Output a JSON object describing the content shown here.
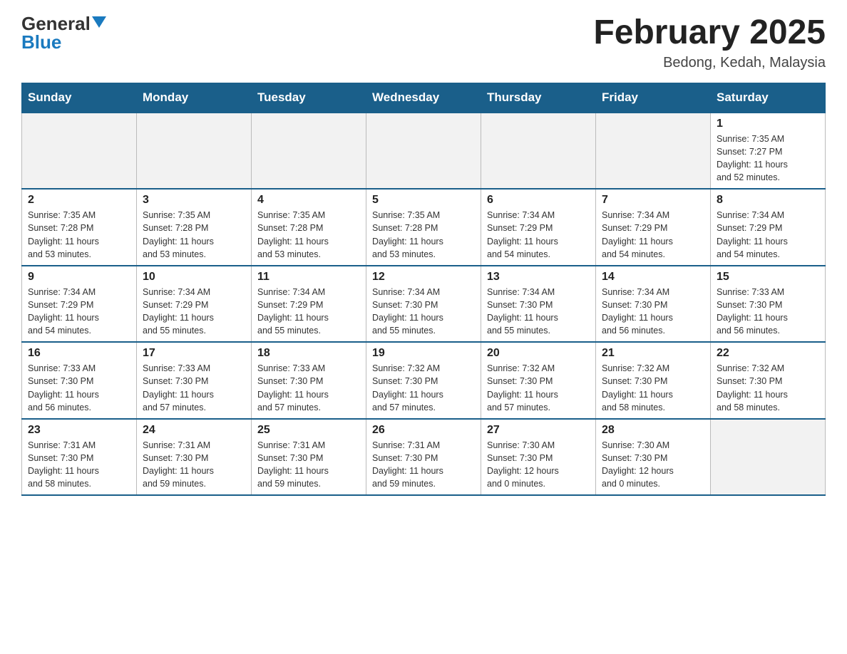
{
  "header": {
    "logo_general": "General",
    "logo_blue": "Blue",
    "month_title": "February 2025",
    "location": "Bedong, Kedah, Malaysia"
  },
  "weekdays": [
    "Sunday",
    "Monday",
    "Tuesday",
    "Wednesday",
    "Thursday",
    "Friday",
    "Saturday"
  ],
  "weeks": [
    [
      {
        "day": "",
        "info": ""
      },
      {
        "day": "",
        "info": ""
      },
      {
        "day": "",
        "info": ""
      },
      {
        "day": "",
        "info": ""
      },
      {
        "day": "",
        "info": ""
      },
      {
        "day": "",
        "info": ""
      },
      {
        "day": "1",
        "info": "Sunrise: 7:35 AM\nSunset: 7:27 PM\nDaylight: 11 hours\nand 52 minutes."
      }
    ],
    [
      {
        "day": "2",
        "info": "Sunrise: 7:35 AM\nSunset: 7:28 PM\nDaylight: 11 hours\nand 53 minutes."
      },
      {
        "day": "3",
        "info": "Sunrise: 7:35 AM\nSunset: 7:28 PM\nDaylight: 11 hours\nand 53 minutes."
      },
      {
        "day": "4",
        "info": "Sunrise: 7:35 AM\nSunset: 7:28 PM\nDaylight: 11 hours\nand 53 minutes."
      },
      {
        "day": "5",
        "info": "Sunrise: 7:35 AM\nSunset: 7:28 PM\nDaylight: 11 hours\nand 53 minutes."
      },
      {
        "day": "6",
        "info": "Sunrise: 7:34 AM\nSunset: 7:29 PM\nDaylight: 11 hours\nand 54 minutes."
      },
      {
        "day": "7",
        "info": "Sunrise: 7:34 AM\nSunset: 7:29 PM\nDaylight: 11 hours\nand 54 minutes."
      },
      {
        "day": "8",
        "info": "Sunrise: 7:34 AM\nSunset: 7:29 PM\nDaylight: 11 hours\nand 54 minutes."
      }
    ],
    [
      {
        "day": "9",
        "info": "Sunrise: 7:34 AM\nSunset: 7:29 PM\nDaylight: 11 hours\nand 54 minutes."
      },
      {
        "day": "10",
        "info": "Sunrise: 7:34 AM\nSunset: 7:29 PM\nDaylight: 11 hours\nand 55 minutes."
      },
      {
        "day": "11",
        "info": "Sunrise: 7:34 AM\nSunset: 7:29 PM\nDaylight: 11 hours\nand 55 minutes."
      },
      {
        "day": "12",
        "info": "Sunrise: 7:34 AM\nSunset: 7:30 PM\nDaylight: 11 hours\nand 55 minutes."
      },
      {
        "day": "13",
        "info": "Sunrise: 7:34 AM\nSunset: 7:30 PM\nDaylight: 11 hours\nand 55 minutes."
      },
      {
        "day": "14",
        "info": "Sunrise: 7:34 AM\nSunset: 7:30 PM\nDaylight: 11 hours\nand 56 minutes."
      },
      {
        "day": "15",
        "info": "Sunrise: 7:33 AM\nSunset: 7:30 PM\nDaylight: 11 hours\nand 56 minutes."
      }
    ],
    [
      {
        "day": "16",
        "info": "Sunrise: 7:33 AM\nSunset: 7:30 PM\nDaylight: 11 hours\nand 56 minutes."
      },
      {
        "day": "17",
        "info": "Sunrise: 7:33 AM\nSunset: 7:30 PM\nDaylight: 11 hours\nand 57 minutes."
      },
      {
        "day": "18",
        "info": "Sunrise: 7:33 AM\nSunset: 7:30 PM\nDaylight: 11 hours\nand 57 minutes."
      },
      {
        "day": "19",
        "info": "Sunrise: 7:32 AM\nSunset: 7:30 PM\nDaylight: 11 hours\nand 57 minutes."
      },
      {
        "day": "20",
        "info": "Sunrise: 7:32 AM\nSunset: 7:30 PM\nDaylight: 11 hours\nand 57 minutes."
      },
      {
        "day": "21",
        "info": "Sunrise: 7:32 AM\nSunset: 7:30 PM\nDaylight: 11 hours\nand 58 minutes."
      },
      {
        "day": "22",
        "info": "Sunrise: 7:32 AM\nSunset: 7:30 PM\nDaylight: 11 hours\nand 58 minutes."
      }
    ],
    [
      {
        "day": "23",
        "info": "Sunrise: 7:31 AM\nSunset: 7:30 PM\nDaylight: 11 hours\nand 58 minutes."
      },
      {
        "day": "24",
        "info": "Sunrise: 7:31 AM\nSunset: 7:30 PM\nDaylight: 11 hours\nand 59 minutes."
      },
      {
        "day": "25",
        "info": "Sunrise: 7:31 AM\nSunset: 7:30 PM\nDaylight: 11 hours\nand 59 minutes."
      },
      {
        "day": "26",
        "info": "Sunrise: 7:31 AM\nSunset: 7:30 PM\nDaylight: 11 hours\nand 59 minutes."
      },
      {
        "day": "27",
        "info": "Sunrise: 7:30 AM\nSunset: 7:30 PM\nDaylight: 12 hours\nand 0 minutes."
      },
      {
        "day": "28",
        "info": "Sunrise: 7:30 AM\nSunset: 7:30 PM\nDaylight: 12 hours\nand 0 minutes."
      },
      {
        "day": "",
        "info": ""
      }
    ]
  ]
}
